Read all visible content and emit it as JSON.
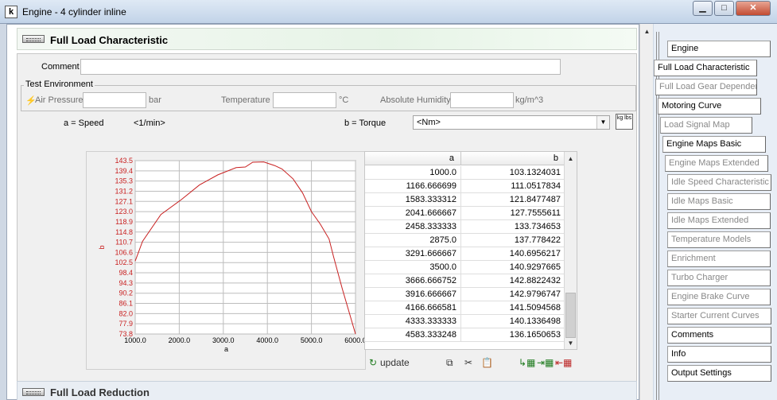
{
  "window": {
    "title": "Engine - 4 cylinder inline",
    "minimize": "▁",
    "maximize": "□",
    "close": "✕"
  },
  "section": {
    "title": "Full Load Characteristic",
    "comment_label": "Comment",
    "comment_value": ""
  },
  "test_environment": {
    "caption": "Test Environment",
    "air_pressure_label": "Air Pressure",
    "air_pressure_unit": "bar",
    "temperature_label": "Temperature",
    "temperature_unit": "°C",
    "humidity_label": "Absolute Humidity",
    "humidity_unit": "kg/m^3"
  },
  "axes_selector": {
    "a_label": "a = Speed",
    "a_unit": "<1/min>",
    "b_label": "b = Torque",
    "b_unit_selected": "<Nm>",
    "unit_toggle": "kg lbs"
  },
  "chart_data": {
    "type": "line",
    "title": "",
    "xlabel": "a",
    "ylabel": "b",
    "xlim": [
      1000.0,
      6000.0
    ],
    "ylim": [
      73.8,
      143.5
    ],
    "x_ticks": [
      "1000.0",
      "2000.0",
      "3000.0",
      "4000.0",
      "5000.0",
      "6000.0"
    ],
    "y_ticks": [
      "73.8",
      "77.9",
      "82.0",
      "86.1",
      "90.2",
      "94.3",
      "98.4",
      "102.5",
      "106.6",
      "110.7",
      "114.8",
      "118.9",
      "123.0",
      "127.1",
      "131.2",
      "135.3",
      "139.4",
      "143.5"
    ],
    "grid": true,
    "series": [
      {
        "color": "#c82020",
        "x": [
          1000.0,
          1166.7,
          1583.3,
          2041.7,
          2458.3,
          2875.0,
          3291.7,
          3500.0,
          3666.7,
          3916.7,
          4166.7,
          4333.3,
          4583.3,
          4800.0,
          5000.0,
          5200.0,
          5400.0,
          5500.0,
          5700.0,
          6000.0
        ],
        "y": [
          103.13,
          111.05,
          121.85,
          127.76,
          133.73,
          137.78,
          140.7,
          140.93,
          142.88,
          142.98,
          141.51,
          140.13,
          136.17,
          130.5,
          123.0,
          118.0,
          112.0,
          105.0,
          92.0,
          73.8
        ]
      }
    ]
  },
  "table": {
    "col_a": "a",
    "col_b": "b",
    "rows": [
      [
        "1000.0",
        "103.1324031"
      ],
      [
        "1166.666699",
        "111.0517834"
      ],
      [
        "1583.333312",
        "121.8477487"
      ],
      [
        "2041.666667",
        "127.7555611"
      ],
      [
        "2458.333333",
        "133.734653"
      ],
      [
        "2875.0",
        "137.778422"
      ],
      [
        "3291.666667",
        "140.6956217"
      ],
      [
        "3500.0",
        "140.9297665"
      ],
      [
        "3666.666752",
        "142.8822432"
      ],
      [
        "3916.666667",
        "142.9796747"
      ],
      [
        "4166.666581",
        "141.5094568"
      ],
      [
        "4333.333333",
        "140.1336498"
      ],
      [
        "4583.333248",
        "136.1650653"
      ]
    ]
  },
  "toolbar": {
    "update_label": "update"
  },
  "section2": {
    "title": "Full Load Reduction"
  },
  "nav": {
    "items": [
      {
        "label": "Engine",
        "enabled": true
      },
      {
        "label": "Full Load Characteristic",
        "enabled": true
      },
      {
        "label": "Full Load Gear Dependent",
        "enabled": false
      },
      {
        "label": "Motoring Curve",
        "enabled": true
      },
      {
        "label": "Load Signal Map",
        "enabled": false
      },
      {
        "label": "Engine Maps Basic",
        "enabled": true
      },
      {
        "label": "Engine Maps Extended",
        "enabled": false
      },
      {
        "label": "Idle Speed Characteristic",
        "enabled": false
      },
      {
        "label": "Idle Maps Basic",
        "enabled": false
      },
      {
        "label": "Idle Maps Extended",
        "enabled": false
      },
      {
        "label": "Temperature Models",
        "enabled": false
      },
      {
        "label": "Enrichment",
        "enabled": false
      },
      {
        "label": "Turbo Charger",
        "enabled": false
      },
      {
        "label": "Engine Brake Curve",
        "enabled": false
      },
      {
        "label": "Starter Current Curves",
        "enabled": false
      },
      {
        "label": "Comments",
        "enabled": true
      },
      {
        "label": "Info",
        "enabled": true
      },
      {
        "label": "Output Settings",
        "enabled": true
      }
    ]
  }
}
